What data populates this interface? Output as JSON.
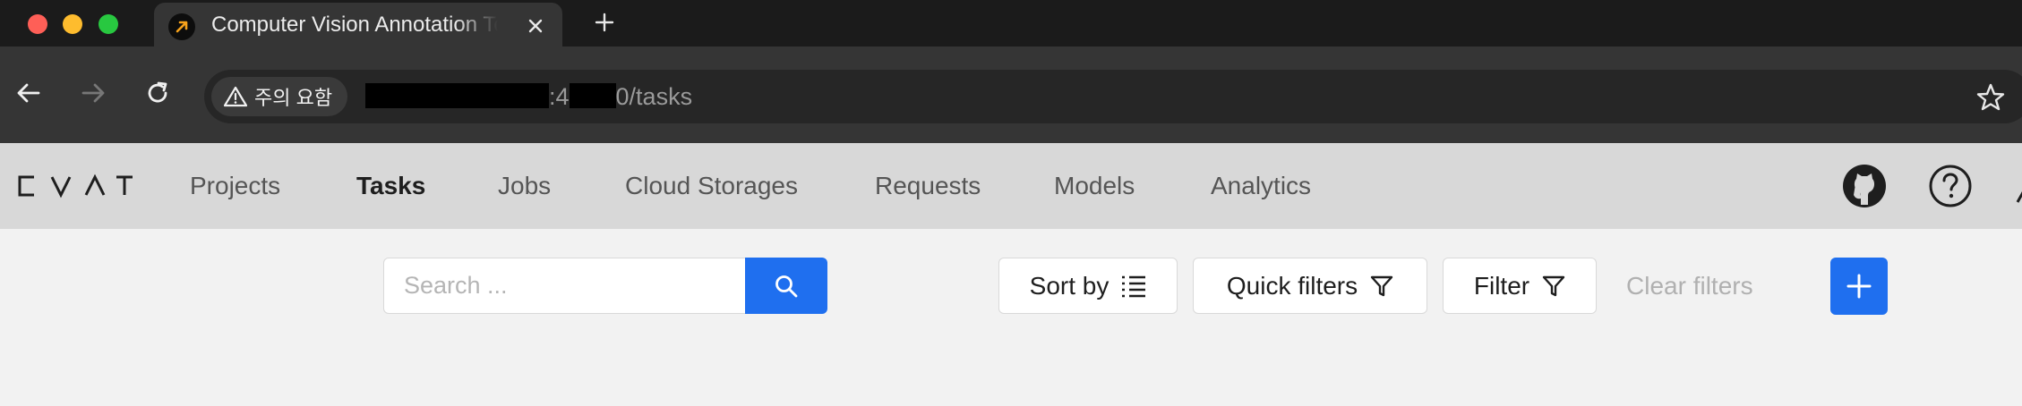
{
  "browser": {
    "tab": {
      "title": "Computer Vision Annotation Tool",
      "favicon": "arrow-up-right-icon"
    },
    "omnibox": {
      "security_label": "주의 요함",
      "url_host_suffix": ":4",
      "url_path": "0/tasks"
    },
    "icons": [
      "back-arrow-icon",
      "forward-arrow-icon",
      "reload-icon",
      "warning-icon",
      "star-icon",
      "close-icon",
      "plus-icon"
    ]
  },
  "app": {
    "logo": "CVAT",
    "nav": [
      {
        "label": "Projects",
        "active": false
      },
      {
        "label": "Tasks",
        "active": true
      },
      {
        "label": "Jobs",
        "active": false
      },
      {
        "label": "Cloud Storages",
        "active": false
      },
      {
        "label": "Requests",
        "active": false
      },
      {
        "label": "Models",
        "active": false
      },
      {
        "label": "Analytics",
        "active": false
      }
    ],
    "header_icons": [
      "github-icon",
      "help-icon"
    ]
  },
  "tasks_toolbar": {
    "search_placeholder": "Search ...",
    "sort_by": "Sort by",
    "quick_filters": "Quick filters",
    "filter": "Filter",
    "clear_filters": "Clear filters"
  },
  "colors": {
    "primary": "#1f6fef",
    "header_bg": "#d8d8d8",
    "content_bg": "#f2f2f2",
    "chrome_dark": "#1b1b1b"
  }
}
